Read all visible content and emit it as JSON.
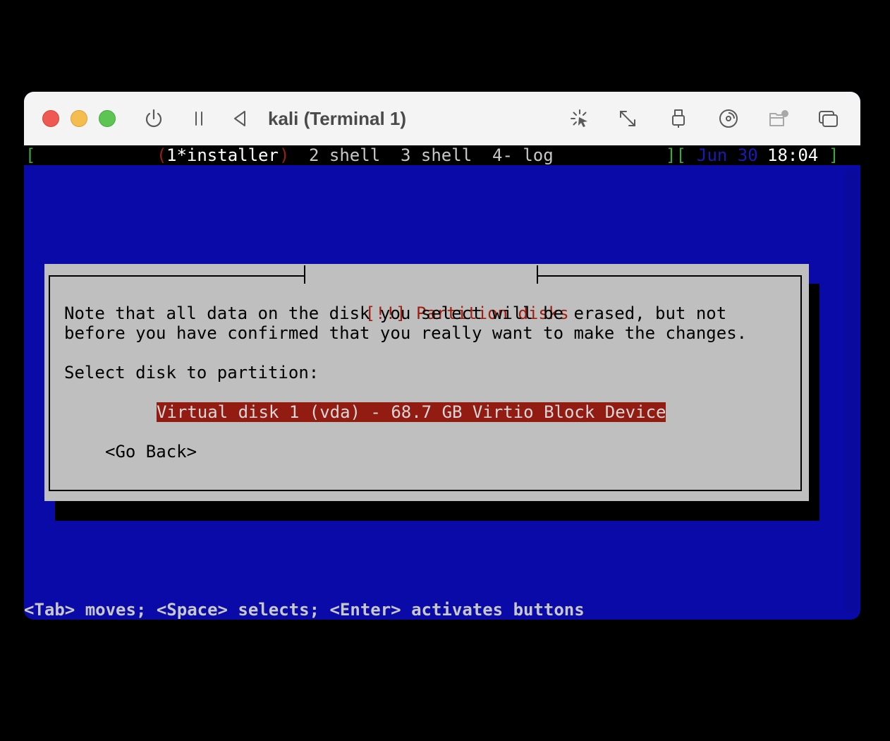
{
  "window": {
    "title": "kali (Terminal 1)"
  },
  "toolbar": {
    "icons": [
      "power-icon",
      "pause-icon",
      "back-triangle-icon",
      "capture-cursor-icon",
      "resize-icon",
      "usb-icon",
      "disc-icon",
      "shared-folder-icon",
      "windows-icon"
    ]
  },
  "statusbar": {
    "left_bracket": "[",
    "tab1_open": "(",
    "tab1_label": "1*installer",
    "tab1_close": ")",
    "tab2_label": "2 shell",
    "tab3_label": "3 shell",
    "tab4_label": "4- log",
    "right_brackets": "][",
    "date": "Jun 30",
    "time": "18:04",
    "end_bracket": "]"
  },
  "dialog": {
    "title": "[!!] Partition disks",
    "line1": "Note that all data on the disk you select will be erased, but not",
    "line2": "before you have confirmed that you really want to make the changes.",
    "prompt": "Select disk to partition:",
    "disk_option": "Virtual disk 1 (vda) - 68.7 GB Virtio Block Device",
    "go_back": "<Go Back>"
  },
  "help": {
    "text": "<Tab> moves; <Space> selects; <Enter> activates buttons"
  },
  "colors": {
    "terminal_bg": "#0a0aa8",
    "dialog_bg": "#bfbfbf",
    "title_red": "#a01e10",
    "selection_bg": "#931c12"
  }
}
